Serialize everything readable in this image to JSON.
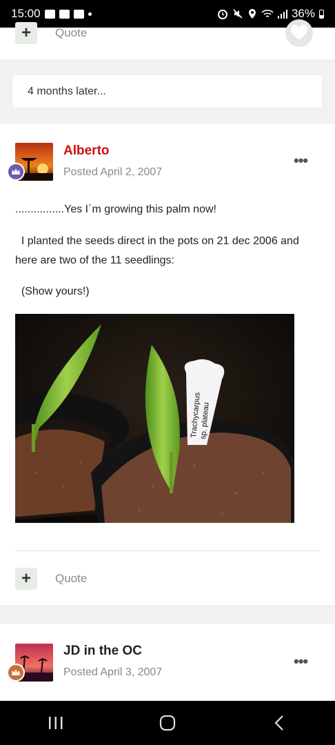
{
  "status_bar": {
    "time": "15:00",
    "battery": "36%"
  },
  "top_post": {
    "quote_label": "Quote"
  },
  "later_note": "4 months later...",
  "post1": {
    "author": "Alberto",
    "author_color": "#cc1111",
    "posted": "Posted April 2, 2007",
    "more": "•••",
    "lines": [
      "................Yes I´m growing this palm now!",
      "  I planted the seeds direct in the pots on 21 dec 2006 and",
      "here are two of the 11 seedlings:",
      "  (Show yours!)"
    ],
    "image_label": "Trachycarpus\nsp. plateau",
    "quote_label": "Quote",
    "plus": "+"
  },
  "post2": {
    "author": "JD in the OC",
    "posted": "Posted April 3, 2007",
    "more": "•••"
  },
  "icons": {
    "heart": "heart-icon",
    "plus": "plus-icon",
    "more": "more-options-icon",
    "badge": "crown-badge-icon",
    "nav_recent": "recent-apps-icon",
    "nav_home": "home-icon",
    "nav_back": "back-icon"
  }
}
